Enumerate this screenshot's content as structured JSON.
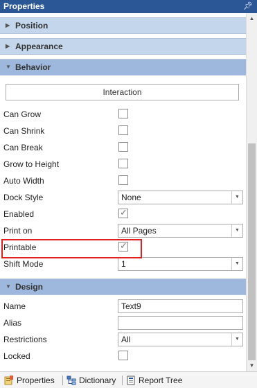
{
  "title": "Properties",
  "sections": {
    "position": "Position",
    "appearance": "Appearance",
    "behavior": "Behavior",
    "design": "Design"
  },
  "interaction_button": "Interaction",
  "behavior": {
    "can_grow": {
      "label": "Can Grow",
      "checked": false
    },
    "can_shrink": {
      "label": "Can Shrink",
      "checked": false
    },
    "can_break": {
      "label": "Can Break",
      "checked": false
    },
    "grow_to_height": {
      "label": "Grow to Height",
      "checked": false
    },
    "auto_width": {
      "label": "Auto Width",
      "checked": false
    },
    "dock_style": {
      "label": "Dock Style",
      "value": "None"
    },
    "enabled": {
      "label": "Enabled",
      "checked": true
    },
    "print_on": {
      "label": "Print on",
      "value": "All Pages"
    },
    "printable": {
      "label": "Printable",
      "checked": true
    },
    "shift_mode": {
      "label": "Shift Mode",
      "value": "1"
    }
  },
  "design": {
    "name": {
      "label": "Name",
      "value": "Text9"
    },
    "alias": {
      "label": "Alias",
      "value": ""
    },
    "restrictions": {
      "label": "Restrictions",
      "value": "All"
    },
    "locked": {
      "label": "Locked",
      "checked": false
    }
  },
  "tabs": {
    "properties": "Properties",
    "dictionary": "Dictionary",
    "report_tree": "Report Tree"
  },
  "colors": {
    "titlebar": "#2b5797",
    "section": "#c4d6ec",
    "highlight": "#e02020"
  }
}
